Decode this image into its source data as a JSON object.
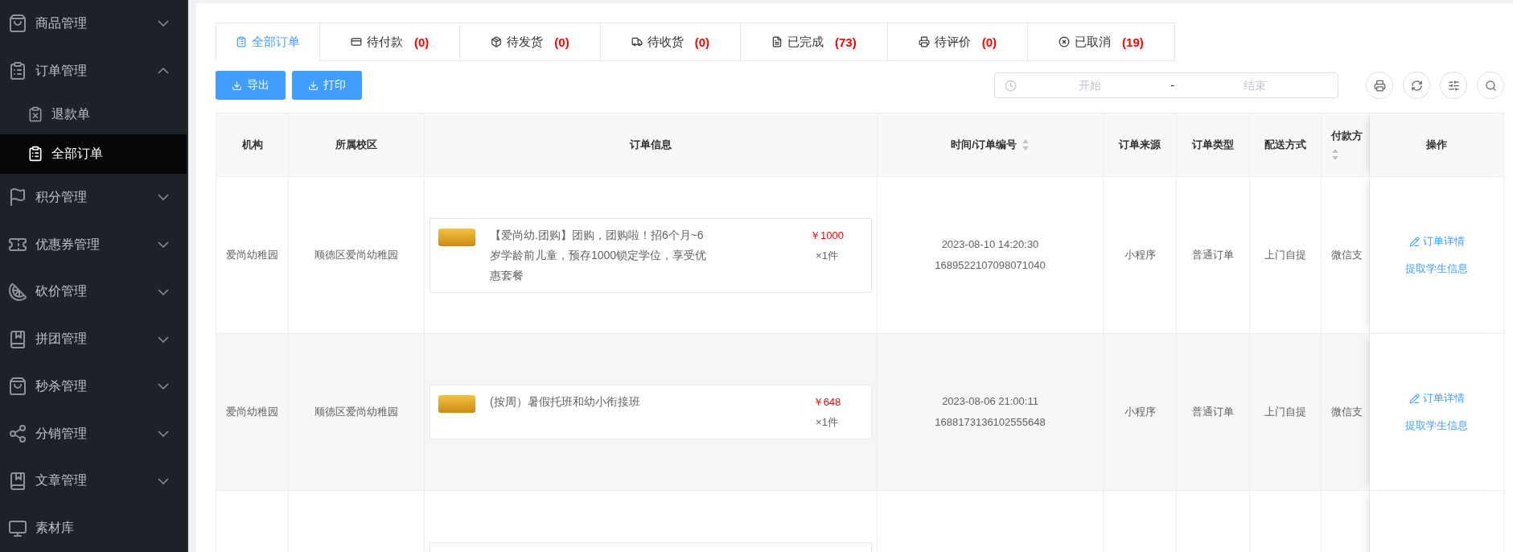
{
  "sidebar": {
    "items": [
      {
        "label": "商品管理",
        "expanded": false
      },
      {
        "label": "订单管理",
        "expanded": true,
        "children": [
          {
            "label": "退款单",
            "selected": false
          },
          {
            "label": "全部订单",
            "selected": true
          }
        ]
      },
      {
        "label": "积分管理",
        "expanded": false
      },
      {
        "label": "优惠券管理",
        "expanded": false
      },
      {
        "label": "砍价管理",
        "expanded": false
      },
      {
        "label": "拼团管理",
        "expanded": false
      },
      {
        "label": "秒杀管理",
        "expanded": false
      },
      {
        "label": "分销管理",
        "expanded": false
      },
      {
        "label": "文章管理",
        "expanded": false
      },
      {
        "label": "素材库"
      }
    ]
  },
  "tabs": [
    {
      "label": "全部订单",
      "selected": true
    },
    {
      "label": "待付款",
      "count": "(0)",
      "selected": false
    },
    {
      "label": "待发货",
      "count": "(0)",
      "selected": false
    },
    {
      "label": "待收货",
      "count": "(0)",
      "selected": false
    },
    {
      "label": "已完成",
      "count": "(73)",
      "selected": false
    },
    {
      "label": "待评价",
      "count": "(0)",
      "selected": false
    },
    {
      "label": "已取消",
      "count": "(19)",
      "selected": false
    }
  ],
  "toolbar": {
    "buttons": [
      "导出",
      "打印"
    ],
    "date_range": {
      "start_placeholder": "开始",
      "separator": "-",
      "end_placeholder": "结束"
    }
  },
  "table": {
    "columns": [
      {
        "label": "机构",
        "sortable": false
      },
      {
        "label": "所属校区",
        "sortable": false
      },
      {
        "label": "订单信息",
        "sortable": false
      },
      {
        "label": "时间/订单编号",
        "sortable": true
      },
      {
        "label": "订单来源",
        "sortable": false
      },
      {
        "label": "订单类型",
        "sortable": false
      },
      {
        "label": "配送方式",
        "sortable": false
      },
      {
        "label": "付款方",
        "sortable": true
      },
      {
        "label": "操作",
        "sortable": false
      }
    ],
    "rows": [
      {
        "org": "爱尚幼稚园",
        "campus": "顺德区爱尚幼稚园",
        "product": "【爱尚幼.团购】团购，团购啦！招6个月~6岁学龄前儿童，预存1000锁定学位，享受优惠套餐",
        "price": "￥1000",
        "quantity": "×1件",
        "time": "2023-08-10 14:20:30",
        "order_no": "1689522107098071040",
        "source": "小程序",
        "type": "普通订单",
        "delivery": "上门自提",
        "payment": "微信支",
        "actions": [
          "订单详情",
          "提取学生信息"
        ]
      },
      {
        "org": "爱尚幼稚园",
        "campus": "顺德区爱尚幼稚园",
        "product": "(按周）暑假托班和幼小衔接班",
        "price": "￥648",
        "quantity": "×1件",
        "time": "2023-08-06 21:00:11",
        "order_no": "1688173136102555648",
        "source": "小程序",
        "type": "普通订单",
        "delivery": "上门自提",
        "payment": "微信支",
        "actions": [
          "订单详情",
          "提取学生信息"
        ]
      },
      {}
    ]
  }
}
